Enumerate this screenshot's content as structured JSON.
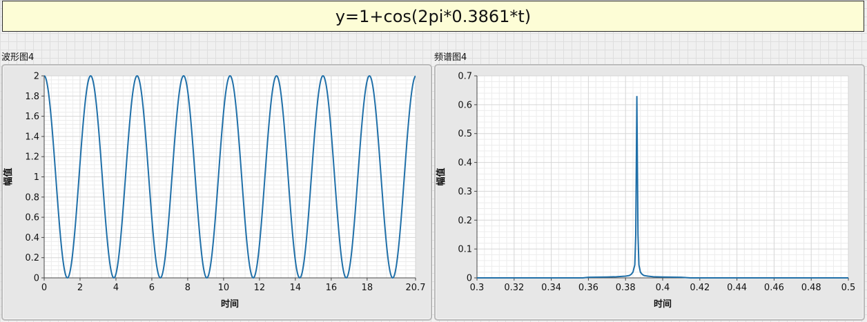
{
  "formula": "y=1+cos(2pi*0.3861*t)",
  "panels": {
    "waveform": {
      "caption": "波形图4"
    },
    "spectrum": {
      "caption": "频谱图4"
    }
  },
  "chart_data": [
    {
      "type": "line",
      "name": "waveform",
      "title": "波形图4",
      "xlabel": "时间",
      "ylabel": "幅值",
      "xlim": [
        0,
        20.7
      ],
      "ylim": [
        0,
        2
      ],
      "xticks": [
        0,
        2,
        4,
        6,
        8,
        10,
        12,
        14,
        16,
        18,
        20.7
      ],
      "xtick_labels": [
        "0",
        "2",
        "4",
        "6",
        "8",
        "10",
        "12",
        "14",
        "16",
        "18",
        "20.7"
      ],
      "yticks": [
        0,
        0.2,
        0.4,
        0.6,
        0.8,
        1,
        1.2,
        1.4,
        1.6,
        1.8,
        2
      ],
      "ytick_labels": [
        "0",
        "0.2",
        "0.4",
        "0.6",
        "0.8",
        "1",
        "1.2",
        "1.4",
        "1.6",
        "1.8",
        "2"
      ],
      "grid": true,
      "series": [
        {
          "function": "1+cos(2*pi*0.3861*t)",
          "frequency": 0.3861,
          "offset": 1,
          "amplitude": 1,
          "color": "#1f6fa8"
        }
      ]
    },
    {
      "type": "line",
      "name": "spectrum",
      "title": "频谱图4",
      "xlabel": "时间",
      "ylabel": "幅值",
      "xlim": [
        0.3,
        0.5
      ],
      "ylim": [
        0,
        0.7
      ],
      "xticks": [
        0.3,
        0.32,
        0.34,
        0.36,
        0.38,
        0.4,
        0.42,
        0.44,
        0.46,
        0.48,
        0.5
      ],
      "xtick_labels": [
        "0.3",
        "0.32",
        "0.34",
        "0.36",
        "0.38",
        "0.4",
        "0.42",
        "0.44",
        "0.46",
        "0.48",
        "0.5"
      ],
      "yticks": [
        0,
        0.1,
        0.2,
        0.3,
        0.4,
        0.5,
        0.6,
        0.7
      ],
      "ytick_labels": [
        "0",
        "0.1",
        "0.2",
        "0.3",
        "0.4",
        "0.5",
        "0.6",
        "0.7"
      ],
      "grid": true,
      "series": [
        {
          "color": "#1f6fa8",
          "x": [
            0.3,
            0.357,
            0.36,
            0.37,
            0.375,
            0.38,
            0.382,
            0.383,
            0.384,
            0.385,
            0.3855,
            0.3861,
            0.3867,
            0.3872,
            0.388,
            0.389,
            0.39,
            0.392,
            0.395,
            0.4,
            0.41,
            0.415,
            0.5
          ],
          "y": [
            0,
            0,
            0.002,
            0.003,
            0.004,
            0.006,
            0.008,
            0.012,
            0.02,
            0.045,
            0.15,
            0.63,
            0.15,
            0.045,
            0.02,
            0.012,
            0.008,
            0.006,
            0.004,
            0.003,
            0.002,
            0,
            0
          ]
        }
      ]
    }
  ]
}
